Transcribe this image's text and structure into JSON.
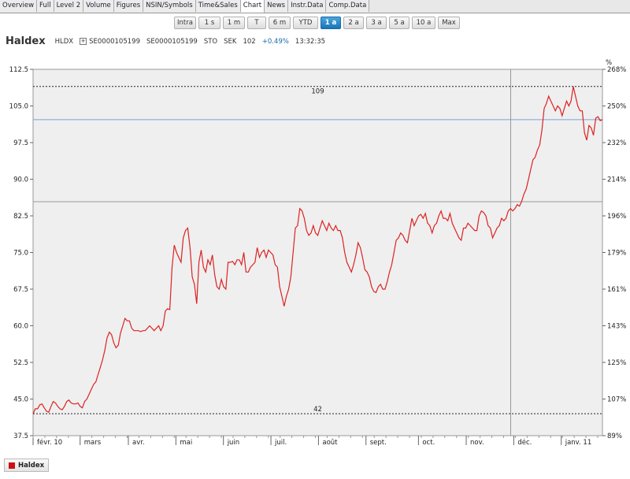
{
  "tabs": [
    {
      "label": "Overview",
      "active": false
    },
    {
      "label": "Full",
      "active": false
    },
    {
      "label": "Level 2",
      "active": false
    },
    {
      "label": "Volume",
      "active": false
    },
    {
      "label": "Figures",
      "active": false
    },
    {
      "label": "NSIN/Symbols",
      "active": false
    },
    {
      "label": "Time&Sales",
      "active": false
    },
    {
      "label": "Chart",
      "active": true
    },
    {
      "label": "News",
      "active": false
    },
    {
      "label": "Instr.Data",
      "active": false
    },
    {
      "label": "Comp.Data",
      "active": false
    }
  ],
  "periods": [
    {
      "label": "Intra",
      "active": false
    },
    {
      "label": "1 s",
      "active": false
    },
    {
      "label": "1 m",
      "active": false
    },
    {
      "label": "T",
      "active": false
    },
    {
      "label": "6 m",
      "active": false
    },
    {
      "label": "YTD",
      "active": false
    },
    {
      "label": "1 a",
      "active": true
    },
    {
      "label": "2 a",
      "active": false
    },
    {
      "label": "3 a",
      "active": false
    },
    {
      "label": "5 a",
      "active": false
    },
    {
      "label": "10 a",
      "active": false
    },
    {
      "label": "Max",
      "active": false
    }
  ],
  "quote": {
    "name": "Haldex",
    "symbol": "HLDX",
    "plus": "+",
    "isin1": "SE0000105199",
    "isin2": "SE0000105199",
    "market": "STO",
    "currency": "SEK",
    "price": "102",
    "change": "+0.49%",
    "time": "13:32:35"
  },
  "legend": {
    "label": "Haldex",
    "color": "#cc1111"
  },
  "chart_data": {
    "type": "line",
    "ylim": [
      37.5,
      112.5
    ],
    "y_ticks": [
      "37.5",
      "45.0",
      "52.5",
      "60.0",
      "67.5",
      "75.0",
      "82.5",
      "90.0",
      "97.5",
      "105.0",
      "112.5"
    ],
    "right_axis_unit": "%",
    "right_ticks": [
      "89%",
      "107%",
      "125%",
      "143%",
      "161%",
      "179%",
      "196%",
      "214%",
      "232%",
      "250%",
      "268%"
    ],
    "x_labels": [
      "févr. 10",
      "mars",
      "avr.",
      "mai",
      "juin",
      "juil.",
      "août",
      "sept.",
      "oct.",
      "nov.",
      "déc.",
      "janv. 11"
    ],
    "x_label_pos": [
      0,
      20,
      40.5,
      60.7,
      80.9,
      101.1,
      121.3,
      141.5,
      163.8,
      184.1,
      204.3,
      224.5
    ],
    "x_max": 242,
    "max_line": {
      "value": 109,
      "label": "109"
    },
    "min_line": {
      "value": 42,
      "label": "42"
    },
    "current_line": 102.2,
    "reference_line": 85.4,
    "vertical_marker_x": 203,
    "series": [
      {
        "color": "#dd2222",
        "values": [
          42,
          43,
          43,
          43.8,
          44,
          43.2,
          42.5,
          42.3,
          43.5,
          44.5,
          44.2,
          43.5,
          43,
          42.8,
          43.5,
          44.5,
          44.8,
          44.2,
          44,
          44,
          44.2,
          43.5,
          43.2,
          44.5,
          45,
          46,
          47,
          48,
          48.5,
          50,
          51.5,
          53,
          55,
          57.5,
          58.7,
          58.2,
          56.5,
          55.5,
          56,
          58.5,
          60,
          61.5,
          61,
          61,
          59.5,
          59,
          59,
          59,
          58.8,
          59,
          59,
          59.5,
          60,
          59.5,
          59,
          59.5,
          60,
          59,
          60,
          63,
          63.5,
          63.3,
          72,
          76.5,
          75,
          74,
          73,
          78,
          79.5,
          80,
          76,
          70,
          68.5,
          64.5,
          73,
          75.5,
          72,
          71,
          73.5,
          72.5,
          74.5,
          70.5,
          68,
          67.5,
          69.5,
          68,
          67.5,
          73,
          73,
          73.2,
          72.5,
          73.5,
          73.5,
          72.5,
          75,
          71,
          71,
          72,
          72.5,
          73,
          76,
          74,
          75,
          75.5,
          74,
          75.5,
          75,
          74.5,
          72.5,
          72,
          68,
          66,
          64,
          66,
          67.5,
          70,
          75,
          80,
          80.5,
          84,
          83.5,
          82,
          79.5,
          78.5,
          79,
          80.5,
          79,
          78.5,
          80,
          81.5,
          80.5,
          79.5,
          81,
          80,
          79.5,
          80.5,
          79.5,
          79.5,
          78,
          75,
          73,
          72,
          71,
          72.5,
          74.5,
          77,
          76,
          74,
          71.5,
          71,
          70,
          68,
          67,
          66.8,
          68,
          68.5,
          67.5,
          67.5,
          69,
          71,
          72.5,
          75,
          77.5,
          78,
          79,
          78.5,
          77.5,
          77,
          79.5,
          82,
          80.5,
          81.5,
          82.5,
          82.8,
          82,
          83,
          81,
          80.5,
          79,
          80.5,
          81,
          82.5,
          83.5,
          82,
          82,
          81.5,
          83,
          81,
          80,
          79,
          78,
          77.5,
          80,
          80,
          81,
          80.5,
          80,
          79.5,
          79.5,
          82.5,
          83.5,
          83.2,
          82.5,
          80.5,
          80,
          78,
          79,
          80,
          80.5,
          82,
          81.5,
          82,
          83.5,
          84,
          83.5,
          84,
          84.8,
          84.5,
          85.5,
          87,
          88,
          90,
          92,
          94,
          94.5,
          96,
          97,
          100,
          104.5,
          105.5,
          107,
          106,
          105,
          104,
          105,
          104.5,
          103,
          104.5,
          106,
          105,
          106,
          109,
          107,
          105,
          104,
          104,
          99.5,
          98,
          101,
          100.5,
          99,
          102.5,
          102.8,
          102,
          102.2
        ]
      }
    ]
  }
}
